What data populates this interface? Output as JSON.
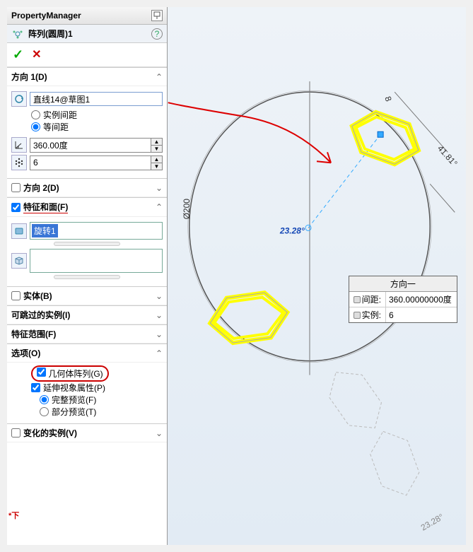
{
  "header": {
    "title": "PropertyManager"
  },
  "feature": {
    "name": "阵列(圆周)1"
  },
  "sections": {
    "dir1": {
      "label": "方向 1(D)",
      "axis_value": "直线14@草图1",
      "spacing_modes": {
        "instance": "实例间距",
        "equal": "等间距"
      },
      "angle": "360.00度",
      "count": "6"
    },
    "dir2": {
      "label": "方向 2(D)"
    },
    "features": {
      "label": "特征和面(F)",
      "sel1": "旋转1"
    },
    "bodies": {
      "label": "实体(B)"
    },
    "skip": {
      "label": "可跳过的实例(I)"
    },
    "scope": {
      "label": "特征范围(F)"
    },
    "options": {
      "label": "选项(O)",
      "geom_pattern": "几何体阵列(G)",
      "extend_visual": "延伸视象属性(P)",
      "full_preview": "完整预览(F)",
      "partial_preview": "部分预览(T)"
    },
    "vary": {
      "label": "变化的实例(V)"
    }
  },
  "callout": {
    "title": "方向一",
    "spacing_label": "间距:",
    "spacing_value": "360.00000000度",
    "instances_label": "实例:",
    "instances_value": "6"
  },
  "viewport_dims": {
    "diameter_label": "Ø200",
    "angle1": "23.28°",
    "angle2": "41.81°",
    "angle3": "23.28°",
    "length_label": "8"
  },
  "flag_text": "*下"
}
